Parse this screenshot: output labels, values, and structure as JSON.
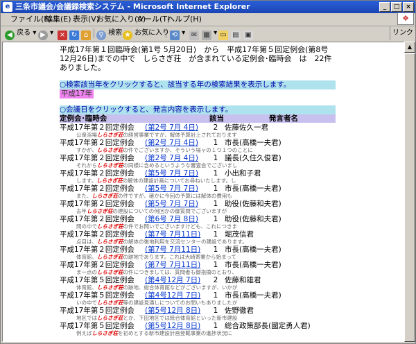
{
  "window": {
    "title": "三条市議会/会議録検索システム - Microsoft Internet Explorer"
  },
  "menu": [
    "ファイル(F)",
    "編集(E)",
    "表示(V)",
    "お気に入り(A)",
    "ツール(T)",
    "ヘルプ(H)"
  ],
  "toolbar": {
    "back": "戻る",
    "search": "検索",
    "favorites": "お気に入り",
    "links": "リンク"
  },
  "page": {
    "intro": "平成17年第１回臨時会(第1号 5月20日)　から　平成17年第５回定例会(第8号12月26日)までの中で　しらさぎ荘　が含まれている定例会･臨時会　は　22件　ありました。",
    "instruction_year": "○検索該当年をクリックすると、該当する年の検索結果を表示します。",
    "year_link": "平成17年",
    "instruction_day": "○会議日をクリックすると、発言内容を表示します。",
    "headers": {
      "session": "定例会･臨時会",
      "count": "該当",
      "speaker": "発言者名"
    },
    "keyword": "しらさぎ荘",
    "records": [
      {
        "session": "平成17年第２回定例会",
        "date": "(第2号 7月 4日)",
        "count": "2",
        "speaker": "佐藤佐久一君",
        "pre": "公衆浴場",
        "post": "の経営事業ですが、解体予算計上されております"
      },
      {
        "session": "平成17年第２回定例会",
        "date": "(第2号 7月 4日)",
        "count": "1",
        "speaker": "市長(高橋一夫君)",
        "pre": "すかが、",
        "post": "の件でございますか、そういう場ャの１つ１つのことに"
      },
      {
        "session": "平成17年第２回定例会",
        "date": "(第2号 7月 4日)",
        "count": "1",
        "speaker": "議長(久住久俊君)",
        "pre": "それから",
        "post": "の同様に含めるというような審査会でございまし"
      },
      {
        "session": "平成17年第２回定例会",
        "date": "(第5号 7月 7日)",
        "count": "1",
        "speaker": "小出和子君",
        "pre": "します。",
        "post": "の解体の建設計画についてお尋ねいたします。し"
      },
      {
        "session": "平成17年第２回定例会",
        "date": "(第5号 7月 7日)",
        "count": "1",
        "speaker": "市長(高橋一夫君)",
        "pre": "また、",
        "post": "の件ですが、確かに今回の予算には解体の費用も"
      },
      {
        "session": "平成17年第２回定例会",
        "date": "(第5号 7月 7日)",
        "count": "1",
        "speaker": "助役(佐藤和夫君)",
        "pre": "去年",
        "post": "の建設についての何回かの御質問でございますが"
      },
      {
        "session": "平成17年第２回定例会",
        "date": "(第6号 7月 8日)",
        "count": "1",
        "speaker": "助役(佐藤和夫君)",
        "pre": "問の中で",
        "post": "の件でお問いでございますけども、これにつきま"
      },
      {
        "session": "平成17年第２回定例会",
        "date": "(第7号 7月11日)",
        "count": "1",
        "speaker": "堀茂信君",
        "pre": "点目は、",
        "post": "の解体の後地利用を交流センターの建設であります。"
      },
      {
        "session": "平成17年第２回定例会",
        "date": "(第7号 7月11日)",
        "count": "1",
        "speaker": "市長(高橋一夫君)",
        "pre": "体育館、",
        "post": "の跡地であります。これは大崎寄業から始まって"
      },
      {
        "session": "平成17年第２回定例会",
        "date": "(第7号 7月11日)",
        "count": "1",
        "speaker": "市長(高橋一夫君)",
        "pre": "まー点の",
        "post": "の件につきましては、質問者も御指摘のとおり、"
      },
      {
        "session": "平成17年第５回定例会",
        "date": "(第4号12月 7日)",
        "count": "2",
        "speaker": "佐藤和雄君",
        "pre": "体育館、",
        "post": "の跡地、総合体育館などがございますが、いかが"
      },
      {
        "session": "平成17年第５回定例会",
        "date": "(第4号12月 7日)",
        "count": "1",
        "speaker": "市長(高橋一夫君)",
        "pre": "いの中で",
        "post": "等の建設見通しについてのお問いもありましたが"
      },
      {
        "session": "平成17年第５回定例会",
        "date": "(第5号12月 8日)",
        "count": "1",
        "speaker": "佐野徹君",
        "pre": "地区では",
        "post": "とか、下田地区では統合体育館といった新市建設"
      },
      {
        "session": "平成17年第５回定例会",
        "date": "(第5号12月 8日)",
        "count": "1",
        "speaker": "総合政策部長(國定勇人君)",
        "pre": "例えば",
        "post": "を初めとする新市建設計画登載事業の進捗状況に"
      }
    ]
  },
  "colors": {
    "band": "#aee3ee",
    "year": "#ee82ee",
    "header": "#c8c0ee",
    "keyword": "#dd0000",
    "link": "#0033cc"
  }
}
